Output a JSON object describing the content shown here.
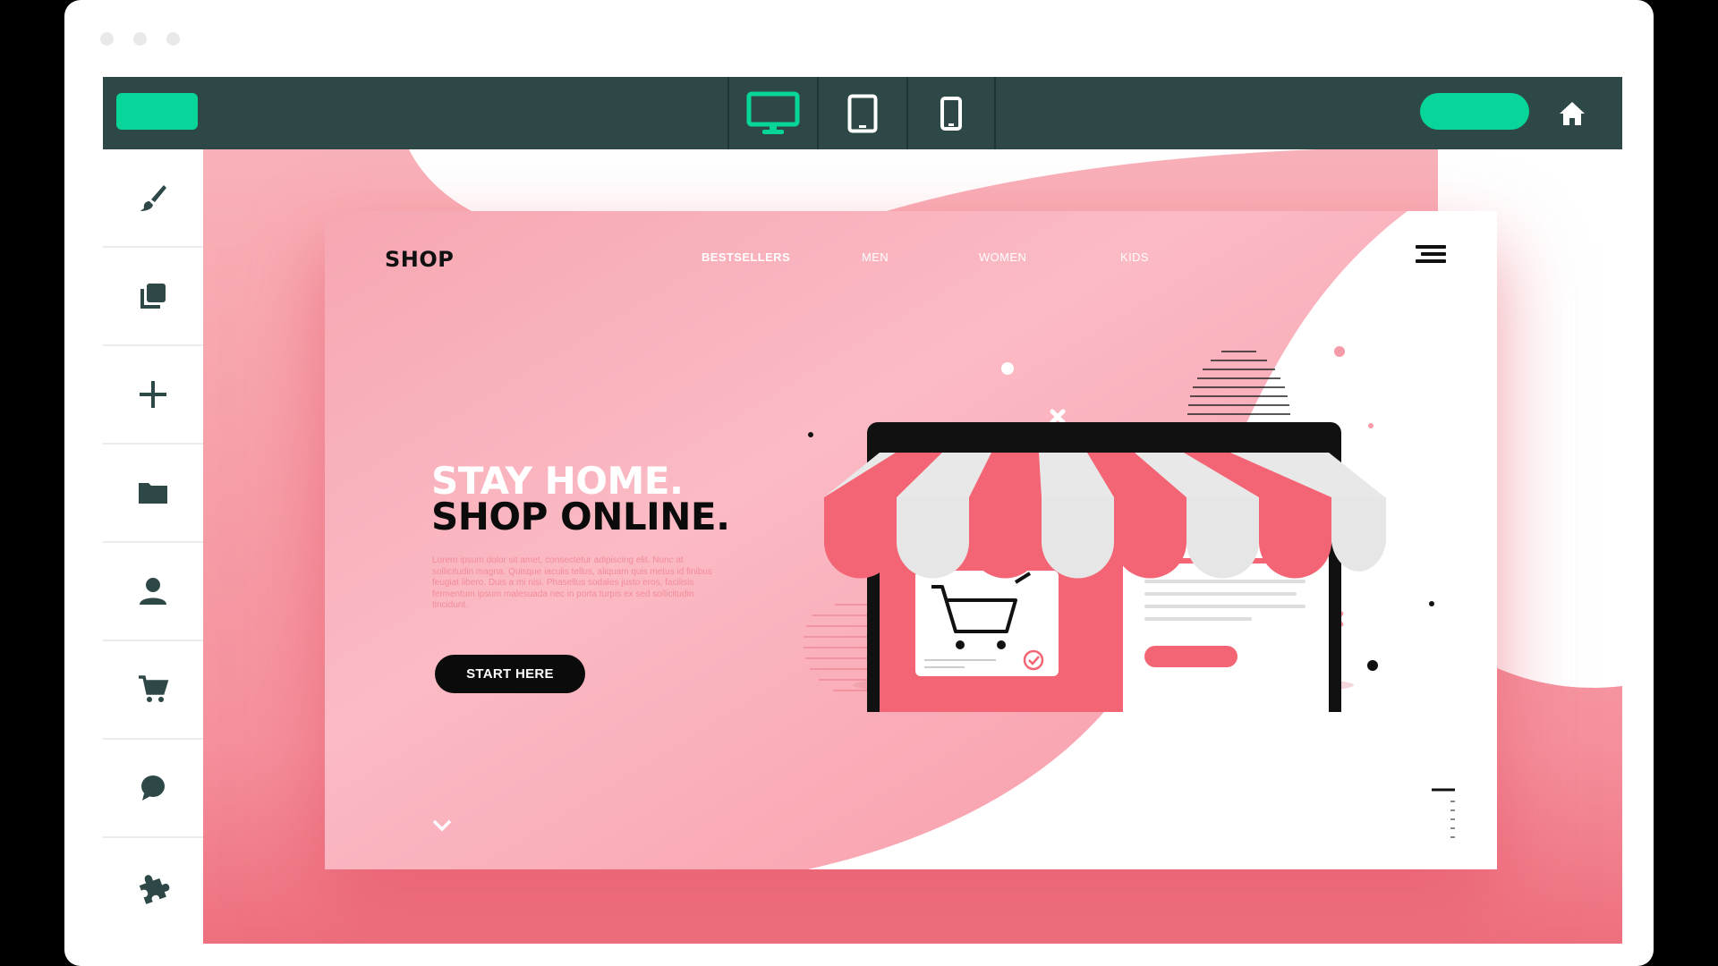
{
  "toolbar": {
    "left_button_label": "",
    "right_button_label": "",
    "devices": [
      "desktop-icon",
      "tablet-icon",
      "mobile-icon"
    ],
    "active_device": "desktop",
    "accent": "#08d59a",
    "bg": "#2e4747"
  },
  "sidebar": {
    "items": [
      "brush-icon",
      "layers-icon",
      "plus-icon",
      "folder-icon",
      "user-icon",
      "cart-icon",
      "chat-icon",
      "puzzle-icon"
    ]
  },
  "site": {
    "logo": "SHOP",
    "nav": [
      "BESTSELLERS",
      "MEN",
      "WOMEN",
      "KIDS"
    ],
    "headline_line1": "STAY HOME.",
    "headline_line2": "SHOP ONLINE.",
    "body": "Lorem ipsum dolor sit amet, consectetur adipiscing elit. Nunc at sollicitudin magna. Quisque iaculis tellus, aliquam quis metus id finibus feugiat libero. Duis a mi nisi. Phasellus sodales justo eros, facilisis fermentum ipsum malesuada nec in porta turpis ex sed sollicitudin tincidunt.",
    "cta": "START HERE",
    "colors": {
      "pink": "#f7aab2",
      "coral": "#f2606d",
      "dark": "#0b0b0b"
    }
  }
}
